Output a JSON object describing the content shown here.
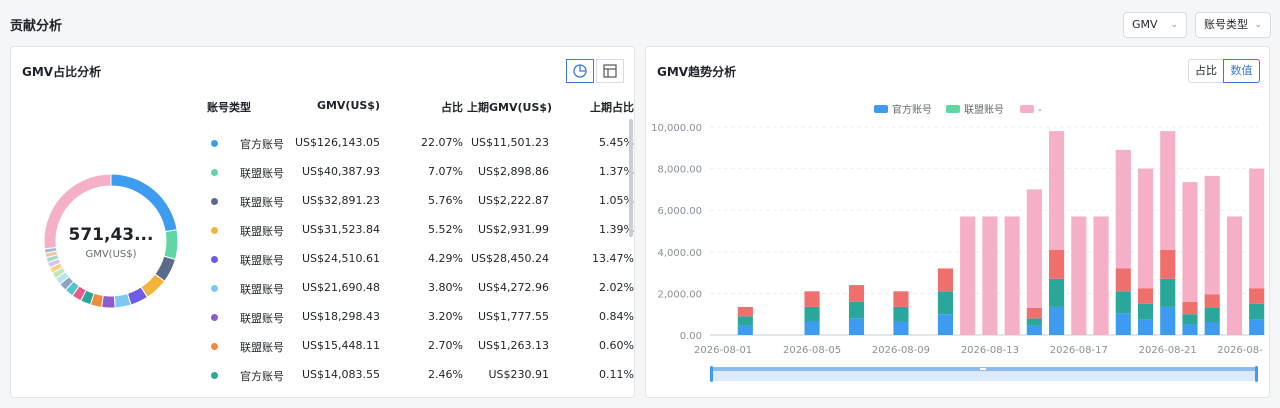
{
  "page": {
    "title": "贡献分析"
  },
  "filters": {
    "metric": "GMV",
    "account_type": "账号类型"
  },
  "left_card": {
    "title": "GMV占比分析",
    "icons": [
      "pie-chart-icon",
      "table-icon"
    ],
    "donut": {
      "total": "571,43...",
      "label": "GMV(US$)"
    },
    "columns": [
      "账号类型",
      "GMV(US$)",
      "占比",
      "上期GMV(US$)",
      "上期占比"
    ],
    "rows": [
      {
        "color": "#3d9cf0",
        "type": "官方账号",
        "gmv": "US$126,143.05",
        "share": "22.07%",
        "prev_gmv": "US$11,501.23",
        "prev_share": "5.45%"
      },
      {
        "color": "#5fd6a4",
        "type": "联盟账号",
        "gmv": "US$40,387.93",
        "share": "7.07%",
        "prev_gmv": "US$2,898.86",
        "prev_share": "1.37%"
      },
      {
        "color": "#5b6b8c",
        "type": "联盟账号",
        "gmv": "US$32,891.23",
        "share": "5.76%",
        "prev_gmv": "US$2,222.87",
        "prev_share": "1.05%"
      },
      {
        "color": "#f4b43b",
        "type": "联盟账号",
        "gmv": "US$31,523.84",
        "share": "5.52%",
        "prev_gmv": "US$2,931.99",
        "prev_share": "1.39%"
      },
      {
        "color": "#6c5ce7",
        "type": "联盟账号",
        "gmv": "US$24,510.61",
        "share": "4.29%",
        "prev_gmv": "US$28,450.24",
        "prev_share": "13.47%"
      },
      {
        "color": "#7cc8f2",
        "type": "联盟账号",
        "gmv": "US$21,690.48",
        "share": "3.80%",
        "prev_gmv": "US$4,272.96",
        "prev_share": "2.02%"
      },
      {
        "color": "#8e5bd1",
        "type": "联盟账号",
        "gmv": "US$18,298.43",
        "share": "3.20%",
        "prev_gmv": "US$1,777.55",
        "prev_share": "0.84%"
      },
      {
        "color": "#f08a3c",
        "type": "联盟账号",
        "gmv": "US$15,448.11",
        "share": "2.70%",
        "prev_gmv": "US$1,263.13",
        "prev_share": "0.60%"
      },
      {
        "color": "#2aa79b",
        "type": "官方账号",
        "gmv": "US$14,083.55",
        "share": "2.46%",
        "prev_gmv": "US$230.91",
        "prev_share": "0.11%"
      }
    ]
  },
  "right_card": {
    "title": "GMV趋势分析",
    "toggle": {
      "share_label": "占比",
      "value_label": "数值"
    }
  },
  "chart_data": {
    "type": "bar",
    "stacked": true,
    "legend_position": "top-center",
    "legend": [
      {
        "name": "官方账号",
        "color": "#3d9cf0"
      },
      {
        "name": "联盟账号",
        "color": "#5fd6a4"
      },
      {
        "name": "-",
        "color": "#f5b0c8"
      }
    ],
    "x_tick_labels": [
      "2026-08-01",
      "2026-08-05",
      "2026-08-09",
      "2026-08-13",
      "2026-08-17",
      "2026-08-21",
      "2026-08-"
    ],
    "y_tick_labels": [
      "0.00",
      "2,000.00",
      "4,000.00",
      "6,000.00",
      "8,000.00",
      "10,000.00"
    ],
    "ylim": [
      0,
      10000
    ],
    "segment_colors": [
      "#3d9cf0",
      "#2aa79b",
      "#ef6f6c",
      "#f5b0c8"
    ],
    "bars": [
      {
        "x": "2026-08-01",
        "stack": [
          0,
          0,
          0,
          0
        ]
      },
      {
        "x": "2026-08-02",
        "stack": [
          450,
          450,
          450,
          0
        ]
      },
      {
        "x": "2026-08-03",
        "stack": [
          0,
          0,
          0,
          0
        ]
      },
      {
        "x": "2026-08-04",
        "stack": [
          0,
          0,
          0,
          0
        ]
      },
      {
        "x": "2026-08-05",
        "stack": [
          650,
          700,
          750,
          0
        ]
      },
      {
        "x": "2026-08-06",
        "stack": [
          0,
          0,
          0,
          0
        ]
      },
      {
        "x": "2026-08-07",
        "stack": [
          800,
          800,
          800,
          0
        ]
      },
      {
        "x": "2026-08-08",
        "stack": [
          0,
          0,
          0,
          0
        ]
      },
      {
        "x": "2026-08-09",
        "stack": [
          650,
          700,
          750,
          0
        ]
      },
      {
        "x": "2026-08-10",
        "stack": [
          0,
          0,
          0,
          0
        ]
      },
      {
        "x": "2026-08-11",
        "stack": [
          1000,
          1100,
          1100,
          0
        ]
      },
      {
        "x": "2026-08-12",
        "stack": [
          0,
          0,
          0,
          5700
        ]
      },
      {
        "x": "2026-08-13",
        "stack": [
          0,
          0,
          0,
          5700
        ]
      },
      {
        "x": "2026-08-14",
        "stack": [
          0,
          0,
          0,
          5700
        ]
      },
      {
        "x": "2026-08-15",
        "stack": [
          450,
          350,
          500,
          5700
        ]
      },
      {
        "x": "2026-08-16",
        "stack": [
          1350,
          1350,
          1400,
          5700
        ]
      },
      {
        "x": "2026-08-17",
        "stack": [
          0,
          0,
          0,
          5700
        ]
      },
      {
        "x": "2026-08-18",
        "stack": [
          0,
          0,
          0,
          5700
        ]
      },
      {
        "x": "2026-08-19",
        "stack": [
          1050,
          1050,
          1100,
          5700
        ]
      },
      {
        "x": "2026-08-20",
        "stack": [
          750,
          750,
          750,
          5750
        ]
      },
      {
        "x": "2026-08-21",
        "stack": [
          1350,
          1350,
          1400,
          5700
        ]
      },
      {
        "x": "2026-08-22",
        "stack": [
          500,
          500,
          600,
          5750
        ]
      },
      {
        "x": "2026-08-23",
        "stack": [
          600,
          700,
          650,
          5700
        ]
      },
      {
        "x": "2026-08-24",
        "stack": [
          0,
          0,
          0,
          5700
        ]
      },
      {
        "x": "2026-08-25",
        "stack": [
          750,
          750,
          750,
          5750
        ]
      }
    ],
    "donut_segments": [
      {
        "name": "官方账号",
        "value": 22.07,
        "color": "#3d9cf0"
      },
      {
        "name": "联盟账号",
        "value": 7.07,
        "color": "#5fd6a4"
      },
      {
        "name": "联盟账号",
        "value": 5.76,
        "color": "#5b6b8c"
      },
      {
        "name": "联盟账号",
        "value": 5.52,
        "color": "#f4b43b"
      },
      {
        "name": "联盟账号",
        "value": 4.29,
        "color": "#6c5ce7"
      },
      {
        "name": "联盟账号",
        "value": 3.8,
        "color": "#7cc8f2"
      },
      {
        "name": "联盟账号",
        "value": 3.2,
        "color": "#8e5bd1"
      },
      {
        "name": "联盟账号",
        "value": 2.7,
        "color": "#f08a3c"
      },
      {
        "name": "官方账号",
        "value": 2.46,
        "color": "#2aa79b"
      },
      {
        "name": "",
        "value": 2.3,
        "color": "#e85a8c"
      },
      {
        "name": "",
        "value": 2.1,
        "color": "#50c7c7"
      },
      {
        "name": "",
        "value": 1.9,
        "color": "#8fa3c7"
      },
      {
        "name": "",
        "value": 1.7,
        "color": "#b8e2f5"
      },
      {
        "name": "",
        "value": 1.5,
        "color": "#c3e6b4"
      },
      {
        "name": "",
        "value": 1.4,
        "color": "#f6d38a"
      },
      {
        "name": "",
        "value": 1.3,
        "color": "#d9c3f1"
      },
      {
        "name": "",
        "value": 1.2,
        "color": "#a5dbc5"
      },
      {
        "name": "",
        "value": 1.1,
        "color": "#f8c5a4"
      },
      {
        "name": "",
        "value": 1.0,
        "color": "#9bb5e8"
      },
      {
        "name": "",
        "value": 26.6,
        "color": "#f5b0c8"
      }
    ]
  }
}
